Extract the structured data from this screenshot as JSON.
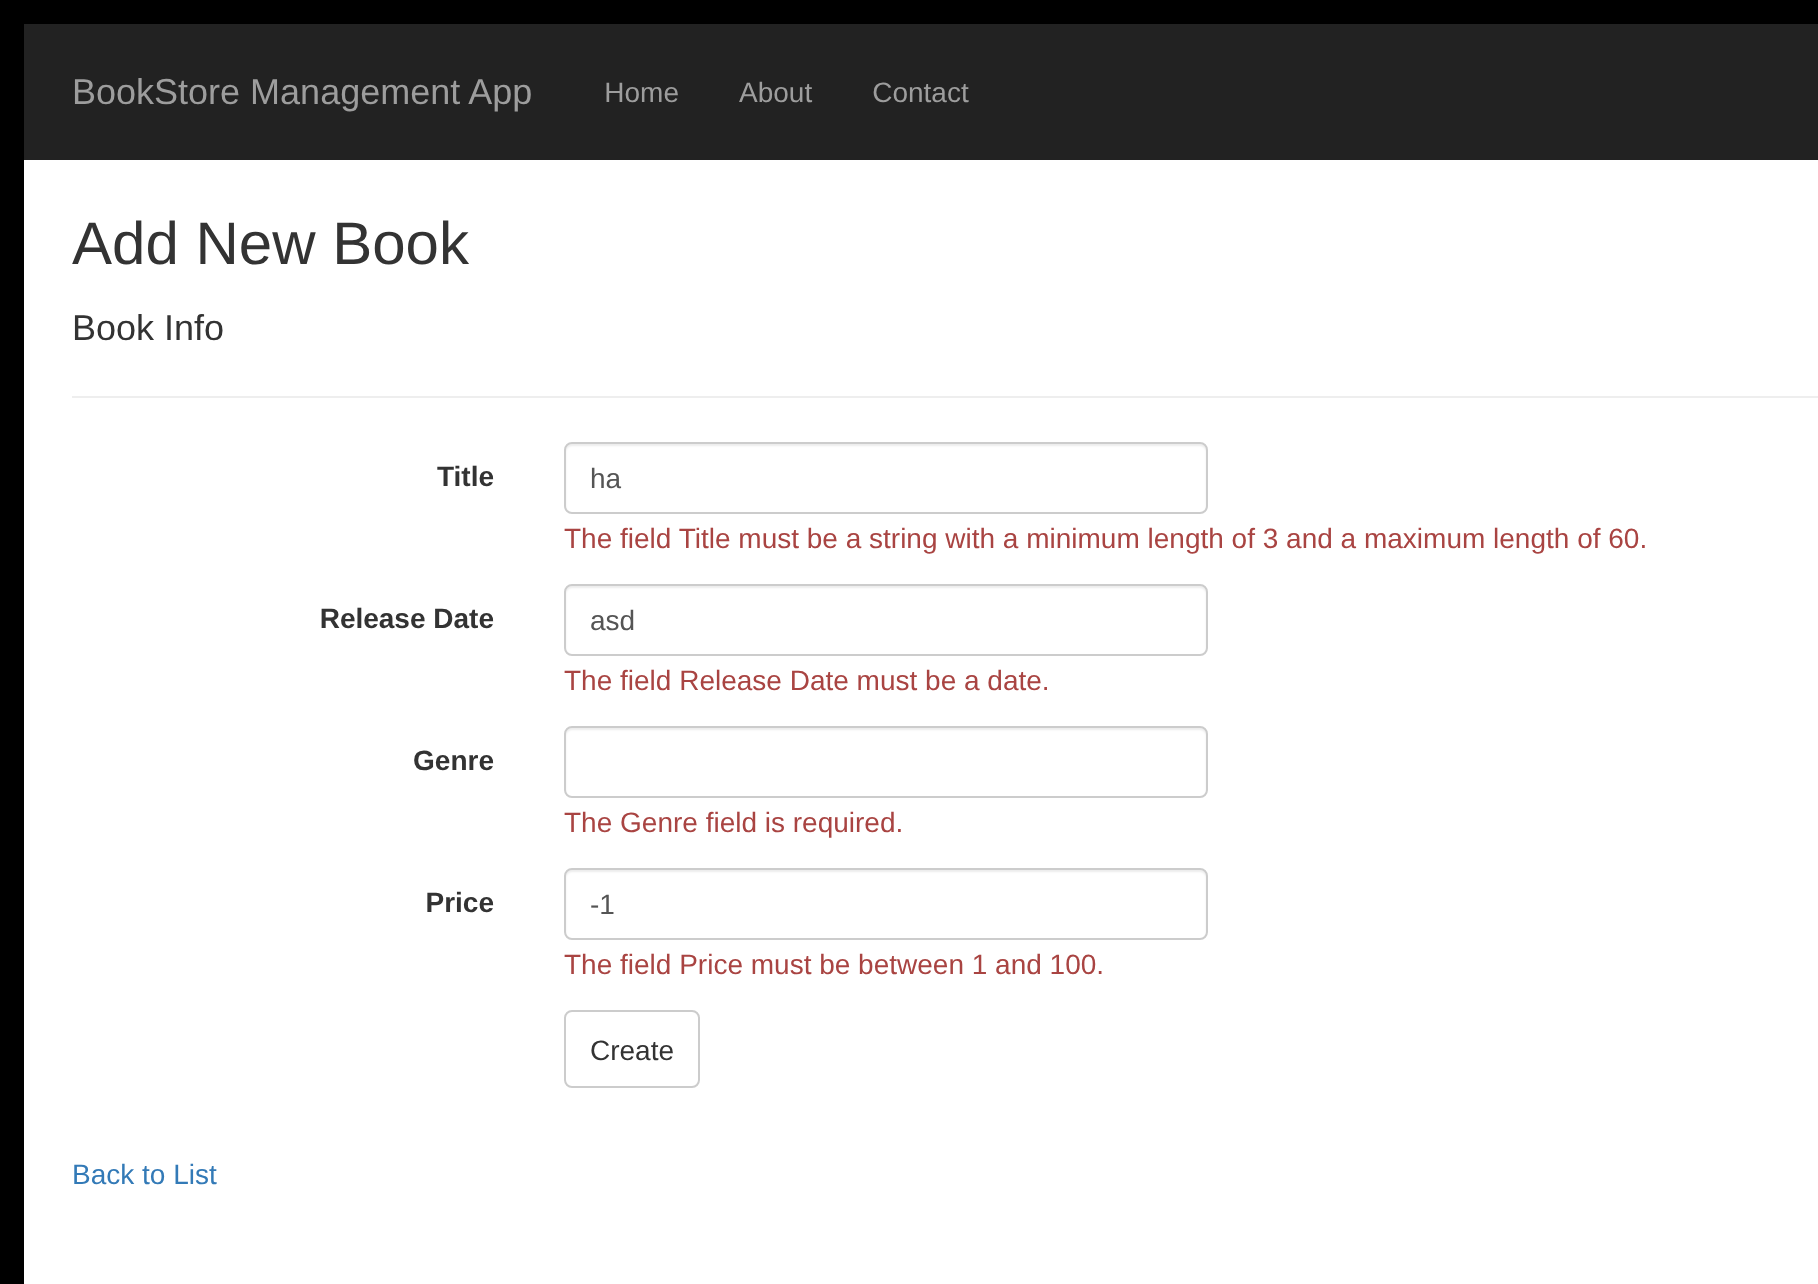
{
  "navbar": {
    "brand": "BookStore Management App",
    "links": [
      {
        "label": "Home"
      },
      {
        "label": "About"
      },
      {
        "label": "Contact"
      }
    ]
  },
  "page": {
    "title": "Add New Book",
    "subtitle": "Book Info"
  },
  "form": {
    "fields": [
      {
        "label": "Title",
        "value": "ha",
        "error": "The field Title must be a string with a minimum length of 3 and a maximum length of 60."
      },
      {
        "label": "Release Date",
        "value": "asd",
        "error": "The field Release Date must be a date."
      },
      {
        "label": "Genre",
        "error": "The Genre field is required."
      },
      {
        "label": "Price",
        "value": "-1",
        "error": "The field Price must be between 1 and 100."
      }
    ],
    "submit": "Create"
  },
  "back_link": "Back to List"
}
